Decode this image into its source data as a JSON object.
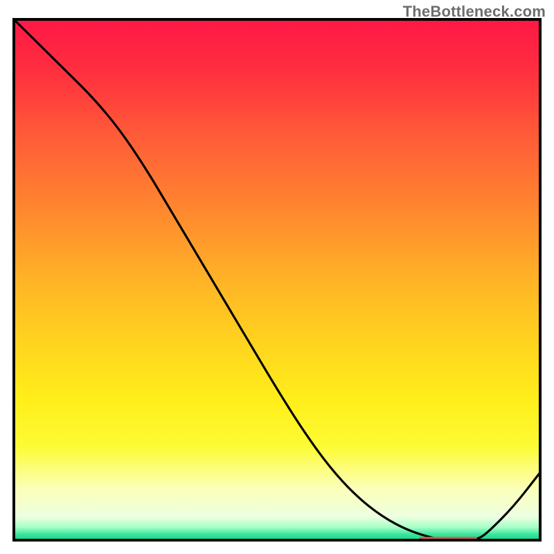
{
  "watermark": "TheBottleneck.com",
  "colors": {
    "gradient_stops": [
      {
        "offset": 0.0,
        "color": "#ff1846"
      },
      {
        "offset": 0.1,
        "color": "#ff2f3f"
      },
      {
        "offset": 0.22,
        "color": "#ff5a38"
      },
      {
        "offset": 0.35,
        "color": "#ff8230"
      },
      {
        "offset": 0.5,
        "color": "#ffb326"
      },
      {
        "offset": 0.63,
        "color": "#ffd61e"
      },
      {
        "offset": 0.73,
        "color": "#ffee1a"
      },
      {
        "offset": 0.82,
        "color": "#fdfb34"
      },
      {
        "offset": 0.9,
        "color": "#fbffb8"
      },
      {
        "offset": 0.955,
        "color": "#edffe0"
      },
      {
        "offset": 0.975,
        "color": "#a6ffc8"
      },
      {
        "offset": 0.99,
        "color": "#33e39a"
      },
      {
        "offset": 1.0,
        "color": "#19d98c"
      }
    ],
    "line": "#000000",
    "marker": "#d75a52",
    "frame": "#000000"
  },
  "chart_data": {
    "type": "line",
    "title": "",
    "xlabel": "",
    "ylabel": "",
    "xlim": [
      0,
      100
    ],
    "ylim": [
      0,
      100
    ],
    "x": [
      0,
      5,
      10,
      15,
      20,
      25,
      30,
      35,
      40,
      45,
      50,
      55,
      60,
      65,
      70,
      75,
      80,
      82,
      85,
      88,
      90,
      95,
      100
    ],
    "values": [
      100,
      95,
      90,
      85,
      79,
      71.5,
      63,
      54.5,
      46,
      37.5,
      29,
      21,
      14,
      8.5,
      4.5,
      1.8,
      0.3,
      0.05,
      0.0,
      0.1,
      1.4,
      6.5,
      13
    ],
    "marker_region": {
      "x_start": 77,
      "x_end": 88,
      "y": 0.3
    },
    "note": "x is a generic 0–100 horizontal position; values are the curve height as a percentage of the plot area (0 at bottom, 100 at top). No numeric axes are visible in the image, so values are read off relative to the frame."
  }
}
